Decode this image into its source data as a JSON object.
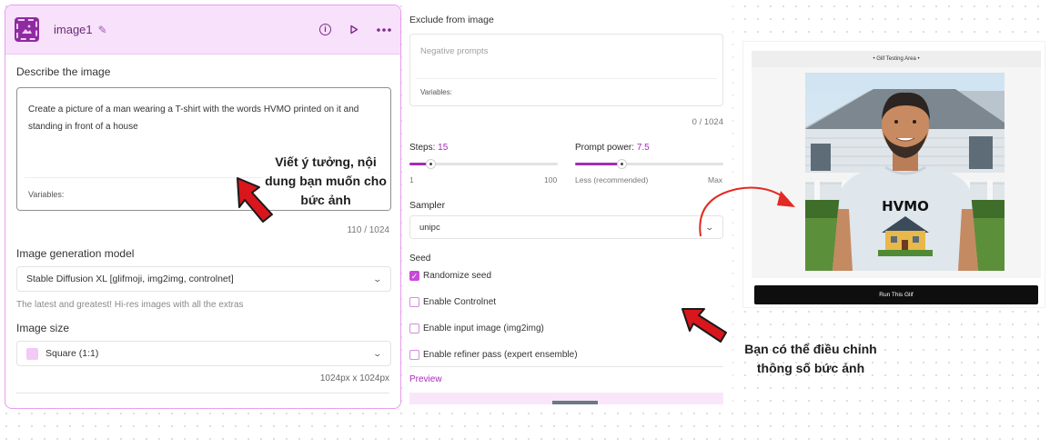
{
  "node": {
    "title": "image1",
    "pencil_icon": "pencil-icon",
    "info_icon": "info-icon",
    "play_icon": "play-icon",
    "more_icon": "more-icon"
  },
  "describe": {
    "label": "Describe the image",
    "value": "Create a picture of a man wearing a T-shirt with the words HVMO printed on it and standing in front of a house",
    "variables_label": "Variables:",
    "counter": "110 / 1024"
  },
  "model": {
    "label": "Image generation model",
    "selected": "Stable Diffusion XL [glifmoji, img2img, controlnet]",
    "hint": "The latest and greatest! Hi-res images with all the extras"
  },
  "size": {
    "label": "Image size",
    "selected": "Square (1:1)",
    "dimensions": "1024px x 1024px"
  },
  "exclude": {
    "label": "Exclude from image",
    "placeholder": "Negative prompts",
    "variables_label": "Variables:",
    "counter": "0 / 1024"
  },
  "steps": {
    "label": "Steps:",
    "value": "15",
    "min": "1",
    "max": "100",
    "fraction": 0.14
  },
  "prompt_power": {
    "label": "Prompt power:",
    "value": "7.5",
    "min_label": "Less (recommended)",
    "max_label": "Max",
    "fraction": 0.31
  },
  "sampler": {
    "label": "Sampler",
    "selected": "unipc"
  },
  "seed": {
    "label": "Seed",
    "options": [
      {
        "label": "Randomize seed",
        "checked": true
      },
      {
        "label": "Enable Controlnet",
        "checked": false
      },
      {
        "label": "Enable input image (img2img)",
        "checked": false
      },
      {
        "label": "Enable refiner pass (expert ensemble)",
        "checked": false
      }
    ]
  },
  "preview": {
    "label": "Preview",
    "area_title": "• Glif Testing Area •",
    "run_button": "Run This Glif",
    "shirt_text": "HVMO"
  },
  "annotations": {
    "left": "Viết ý tưởng, nội dung bạn muốn cho bức ảnh",
    "right": "Bạn có thể điều chỉnh thông số bức ảnh"
  },
  "colors": {
    "accent": "#a62bb8",
    "header_bg": "#f8e1fb",
    "arrow_red": "#d9161c"
  }
}
